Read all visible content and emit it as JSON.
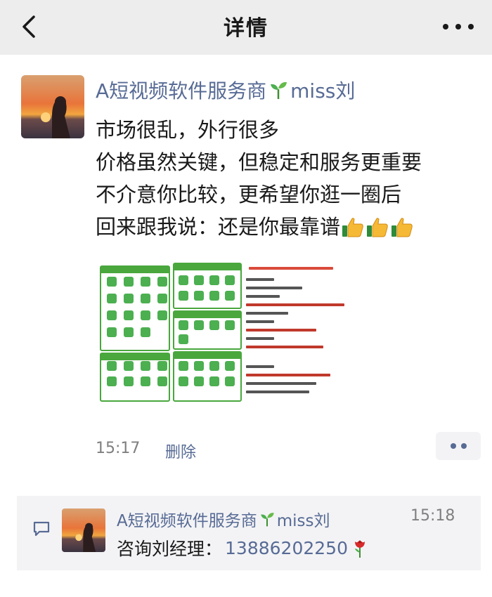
{
  "nav": {
    "title": "详情",
    "back_icon": "chevron-left-icon",
    "more_icon": "more-horizontal-icon"
  },
  "post": {
    "author_name": "A短视频软件服务商",
    "author_suffix": "miss刘",
    "lines": [
      "市场很乱，外行很多",
      "价格虽然关键，但稳定和服务更重要",
      "不介意你比较，更希望你逛一圈后",
      "回来跟我说：还是你最靠谱"
    ],
    "thumb_emoji_count": 3,
    "time": "15:17",
    "delete_label": "删除"
  },
  "comment": {
    "author_name": "A短视频软件服务商",
    "author_suffix": "miss刘",
    "time": "15:18",
    "text_prefix": "咨询刘经理：",
    "phone": "13886202250"
  },
  "colors": {
    "link": "#576b95",
    "navbar_bg": "#ededed",
    "comment_bg": "#f3f3f5",
    "brand_green": "#49a73d"
  }
}
